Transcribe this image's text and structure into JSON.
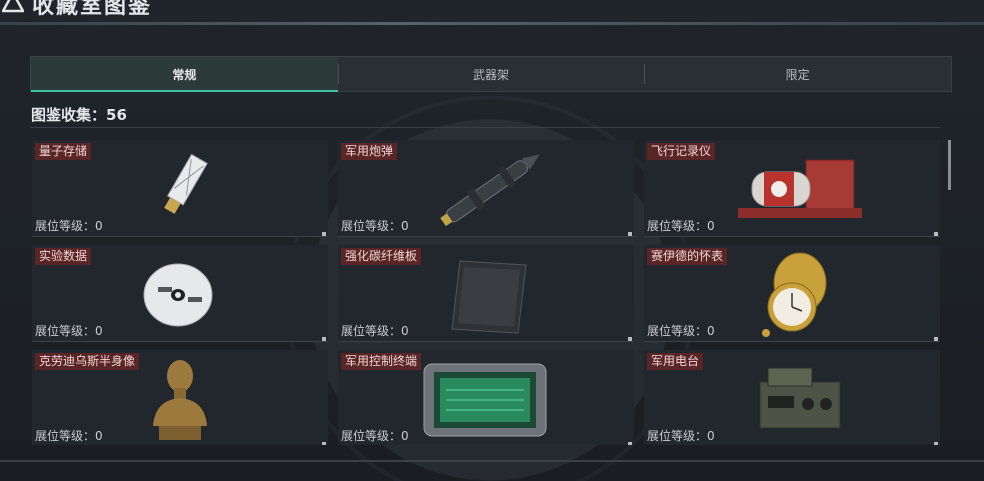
{
  "header": {
    "title": "收藏室图鉴"
  },
  "tabs": [
    {
      "label": "常规"
    },
    {
      "label": "武器架"
    },
    {
      "label": "限定"
    }
  ],
  "collection": {
    "count_label": "图鉴收集：56"
  },
  "items": [
    {
      "name": "量子存储",
      "level": "展位等级：0"
    },
    {
      "name": "军用炮弹",
      "level": "展位等级：0"
    },
    {
      "name": "飞行记录仪",
      "level": "展位等级：0"
    },
    {
      "name": "实验数据",
      "level": "展位等级：0"
    },
    {
      "name": "强化碳纤维板",
      "level": "展位等级：0"
    },
    {
      "name": "赛伊德的怀表",
      "level": "展位等级：0"
    },
    {
      "name": "克劳迪乌斯半身像",
      "level": "展位等级：0"
    },
    {
      "name": "军用控制终端",
      "level": "展位等级：0"
    },
    {
      "name": "军用电台",
      "level": "展位等级：0"
    }
  ],
  "theme": {
    "accent": "#3fc3a6",
    "label_bg": "#5a2526"
  }
}
